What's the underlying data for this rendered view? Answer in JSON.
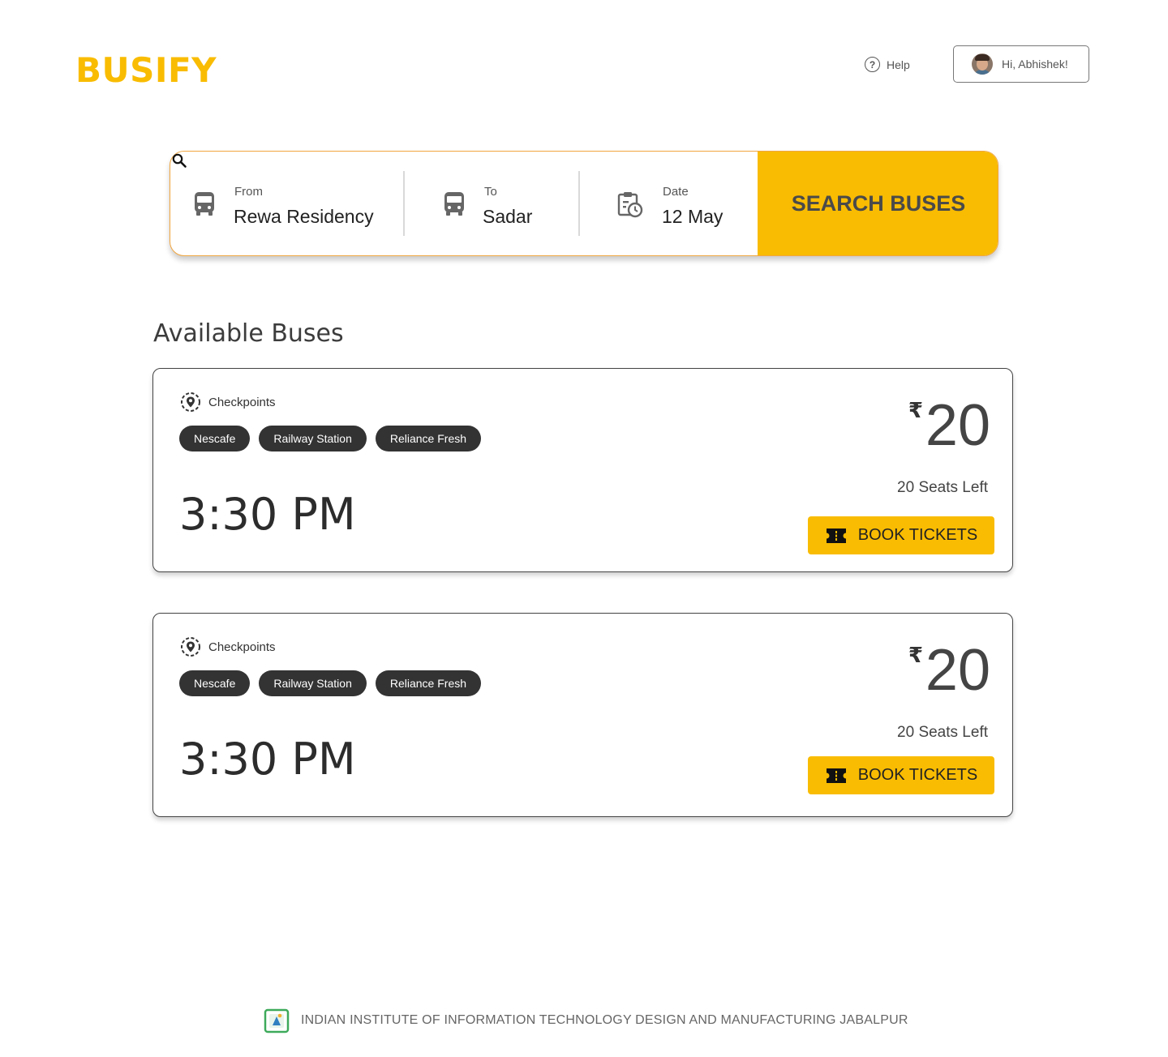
{
  "app": {
    "logo": "BUSIFY"
  },
  "header": {
    "help_label": "Help",
    "user_greeting": "Hi, Abhishek!"
  },
  "search": {
    "from_label": "From",
    "from_value": "Rewa Residency",
    "to_label": "To",
    "to_value": "Sadar",
    "date_label": "Date",
    "date_value": "12 May",
    "button_label": "SEARCH BUSES"
  },
  "section_title": "Available Buses",
  "buses": [
    {
      "checkpoints_label": "Checkpoints",
      "checkpoints": [
        "Nescafe",
        "Railway Station",
        "Reliance Fresh"
      ],
      "time": "3:30 PM",
      "currency": "₹",
      "price": "20",
      "seats_left": "20 Seats Left",
      "book_label": "BOOK TICKETS"
    },
    {
      "checkpoints_label": "Checkpoints",
      "checkpoints": [
        "Nescafe",
        "Railway Station",
        "Reliance Fresh"
      ],
      "time": "3:30 PM",
      "currency": "₹",
      "price": "20",
      "seats_left": "20 Seats Left",
      "book_label": "BOOK TICKETS"
    }
  ],
  "footer": {
    "institute": "INDIAN INSTITUTE OF INFORMATION TECHNOLOGY DESIGN AND MANUFACTURING JABALPUR"
  },
  "colors": {
    "accent": "#F9BC02",
    "chip": "#333333",
    "search_border": "#f0a640"
  }
}
